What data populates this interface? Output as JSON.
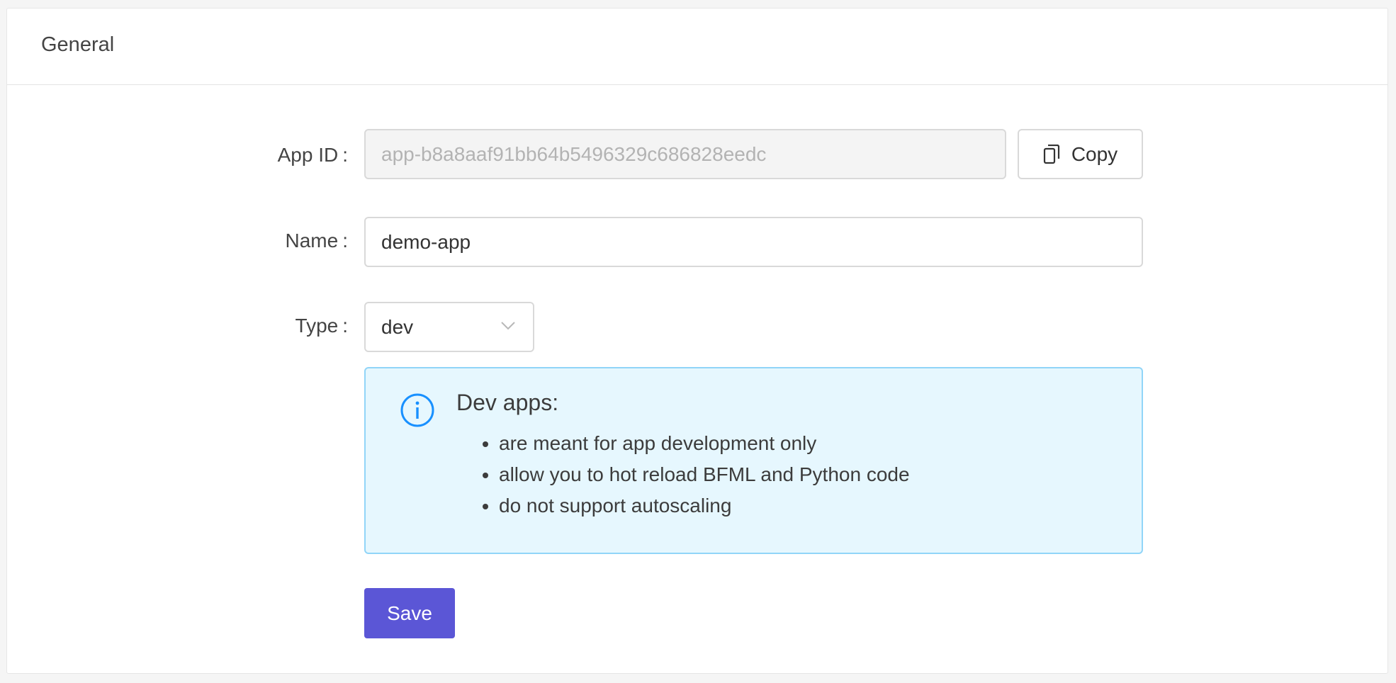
{
  "header": {
    "title": "General"
  },
  "form": {
    "app_id": {
      "label": "App ID",
      "value": "app-b8a8aaf91bb64b5496329c686828eedc",
      "copy_label": "Copy"
    },
    "name": {
      "label": "Name",
      "value": "demo-app"
    },
    "type": {
      "label": "Type",
      "selected": "dev"
    },
    "info": {
      "title": "Dev apps:",
      "items": [
        "are meant for app development only",
        "allow you to hot reload BFML and Python code",
        "do not support autoscaling"
      ]
    },
    "save_label": "Save",
    "colon": ":"
  },
  "colors": {
    "primary": "#5b56d6",
    "info_bg": "#e6f7fe",
    "info_border": "#91d5f8",
    "info_icon": "#1890ff"
  },
  "icons": {
    "copy": "copy-icon",
    "chevron": "chevron-down-icon",
    "info": "info-circle-icon"
  }
}
